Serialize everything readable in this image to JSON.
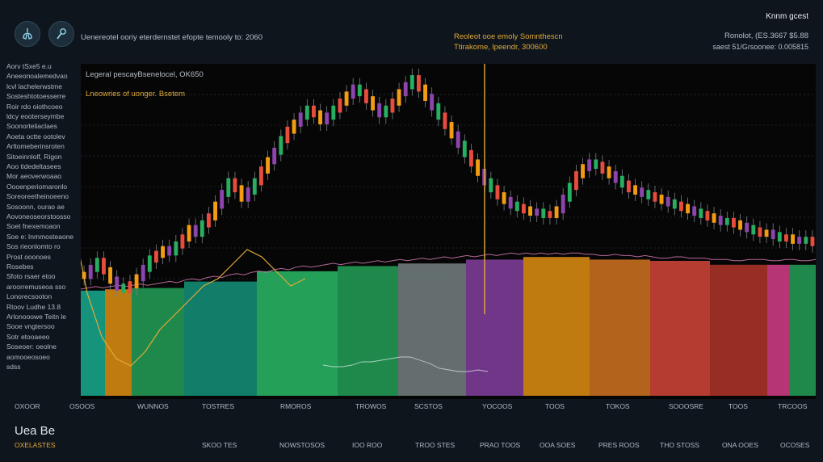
{
  "header": {
    "subtitle": "Uenereotel ooriy eterdernstet efopte temooly to: 2060",
    "center_line1": "Reoleot ooe emoly Somnthescn",
    "center_line2": "Ttirakome, lpeendr, 300600",
    "right_title": "Knnm gcest",
    "right_line1": "Ronolot, (ES.3667 $5.88",
    "right_line2": "saest 51/Grsoonee: 0.005815"
  },
  "icons": [
    "lungs-icon",
    "wrench-icon"
  ],
  "side_labels": [
    "Aorv tSxe5 e.u",
    "Aneeonoalemedvao",
    "lcvl lachelerwstme",
    "Sosteshtotoesserre",
    "Roir rdo oiothcoeo",
    "ldcy eooterseymbe",
    "Soonorteliaclaes",
    "Aoeta octte ootolev",
    "Arltomeberinsroten",
    "Sitoeinnlolf, Rigon",
    "Aoo tidedeltasees",
    "Mor aeoverwoaao",
    "Oooenperiomaronlo",
    "Soreoreetheinoeeno",
    "Sosoonn, ourao ae",
    "Aovoneoseorstoosso",
    "Soet fnexemoaon",
    "Soe e: Inmmosteaone",
    "Sos rieonlomto ro",
    "Prost ooonoes",
    "Rosebes",
    "Sfoto rsaer etoo",
    "aroorremuseoa sso",
    "Lonorecsooton",
    "Rtoov Ludhe 13.8",
    "Arlonooowe Teitn le",
    "Sooe vngtersoo",
    "Sotr etooaeeo",
    "Soseoer: oeolne",
    "aomooeosoeo",
    "sdss"
  ],
  "annotation": {
    "line1": "Legeral pescayBsenelocel, OK650",
    "line2": "Lneowries of uonger. Bsetem"
  },
  "x_labels": [
    "OXOOR",
    "OSOOS",
    "WUNNOS",
    "TOSTRES",
    "RMOROS",
    "TROWOS",
    "SCSTOS",
    "YOCOOS",
    "TOOS",
    "TOKOS",
    "SOOOSRE",
    "TOOS",
    "TRCOOS"
  ],
  "bottom": {
    "title": "Uea Be",
    "subtitle": "OXELASTES",
    "labels": [
      "SKOO TES",
      "NOWSTOSOS",
      "IOO ROO",
      "TROO STES",
      "PRAO TOOS",
      "OOA SOES",
      "PRES ROOS",
      "THO STOSS",
      "ONA OOES",
      "OCOSES"
    ]
  },
  "colors": {
    "up": "#f39c12",
    "down": "#e74c3c",
    "alt1": "#27ae60",
    "alt2": "#8e44ad",
    "accent": "#e0a93a",
    "band_colors": [
      "#1abc9c",
      "#f39c12",
      "#27ae60",
      "#16a085",
      "#2ecc71",
      "#27ae60",
      "#7f8c8d",
      "#8e44ad",
      "#f39c12",
      "#e67e22",
      "#e74c3c",
      "#c0392b",
      "#e84393",
      "#27ae60"
    ]
  },
  "chart_data": {
    "type": "candlestick",
    "title": "",
    "xlabel": "",
    "ylabel": "",
    "grid": true,
    "candles_close": [
      20,
      23,
      26,
      22,
      18,
      15,
      14,
      16,
      19,
      23,
      27,
      29,
      31,
      30,
      33,
      36,
      40,
      38,
      42,
      45,
      50,
      55,
      60,
      57,
      53,
      56,
      60,
      65,
      69,
      73,
      78,
      82,
      85,
      88,
      91,
      89,
      86,
      88,
      91,
      94,
      97,
      100,
      98,
      95,
      92,
      89,
      91,
      94,
      98,
      101,
      104,
      100,
      96,
      92,
      88,
      84,
      80,
      76,
      72,
      68,
      64,
      60,
      57,
      54,
      52,
      50,
      49,
      48,
      47,
      47,
      46,
      46,
      48,
      53,
      58,
      63,
      66,
      68,
      67,
      65,
      63,
      61,
      59,
      57,
      56,
      55,
      54,
      53,
      52,
      51,
      50,
      49,
      48,
      47,
      46,
      45,
      44,
      43,
      43,
      42,
      41,
      40,
      39,
      38,
      38,
      37,
      36,
      36,
      35,
      35,
      35,
      34
    ],
    "wave": [
      10,
      11,
      12,
      11,
      12,
      13,
      12,
      13,
      14,
      13,
      14,
      15,
      16,
      15,
      17,
      18,
      17,
      19,
      20,
      19,
      21,
      22,
      21,
      23,
      24,
      23,
      25,
      26,
      25,
      27,
      28,
      27,
      28,
      29,
      30,
      29,
      30,
      31,
      30,
      31,
      32,
      31,
      32,
      33,
      32,
      33,
      34,
      33,
      34,
      35,
      34,
      35,
      36,
      35,
      36,
      37,
      36,
      37,
      38,
      37,
      38,
      37,
      38,
      37,
      38,
      37,
      38,
      38,
      37,
      37,
      36,
      36,
      37,
      36,
      36,
      35,
      36,
      35,
      34,
      34,
      35,
      35,
      34,
      34,
      34,
      33,
      33,
      33,
      32,
      32,
      33,
      33,
      33,
      32,
      32,
      33,
      33,
      32,
      32,
      33
    ],
    "yellow_line": [
      10,
      12,
      18,
      26,
      32,
      24,
      14,
      8,
      5,
      4,
      6,
      9,
      11,
      13,
      15,
      16,
      18,
      20,
      19,
      17,
      15,
      16
    ],
    "white_line": [
      6,
      5,
      5,
      6,
      8,
      8,
      9,
      10,
      11,
      11,
      9,
      7,
      4,
      3,
      2,
      2,
      3,
      2
    ],
    "y_range": [
      0,
      110
    ]
  }
}
